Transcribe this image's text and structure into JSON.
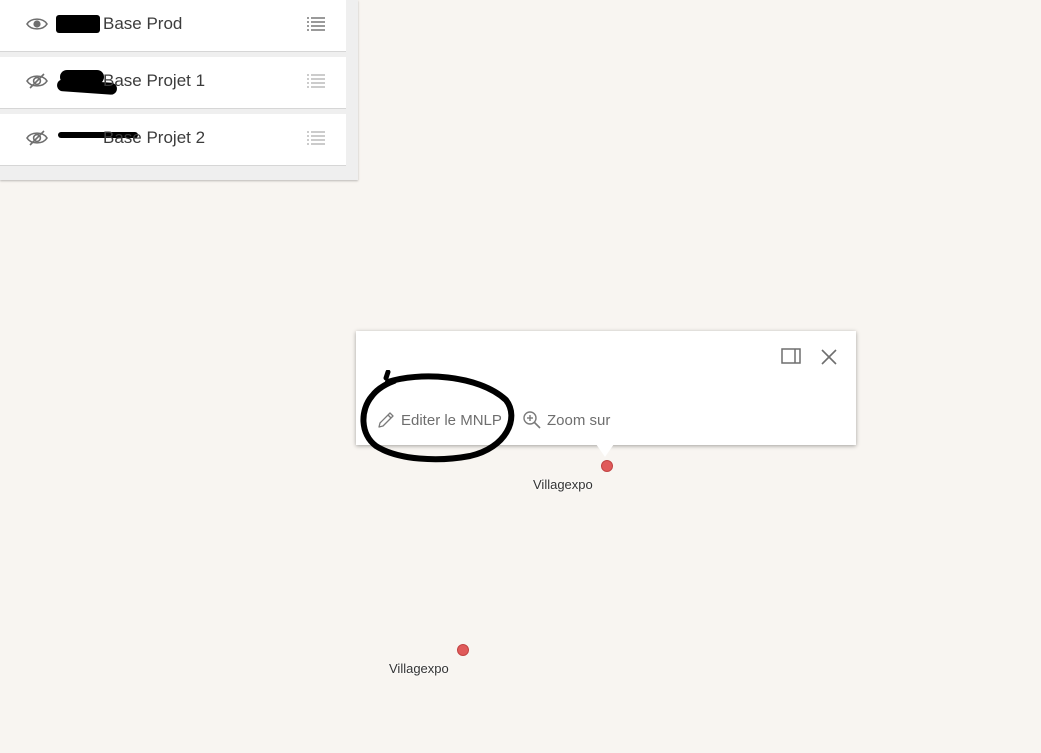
{
  "layers": [
    {
      "label": "Base Prod",
      "visible": true
    },
    {
      "label": "Base Projet 1",
      "visible": false
    },
    {
      "label": "Base Projet 2",
      "visible": false
    }
  ],
  "popup": {
    "actions": {
      "edit_label": "Editer le MNLP",
      "zoom_label": "Zoom sur"
    }
  },
  "features": [
    {
      "label": "Villagexpo"
    },
    {
      "label": "Villagexpo"
    }
  ],
  "colors": {
    "map_background": "#f8f5f1",
    "feature_point": "#e05a5a",
    "annotation_stroke": "#000000"
  },
  "icons": [
    "eye-icon",
    "eye-off-icon",
    "list-menu-icon",
    "dock-icon",
    "close-icon",
    "pencil-icon",
    "zoom-in-icon"
  ]
}
